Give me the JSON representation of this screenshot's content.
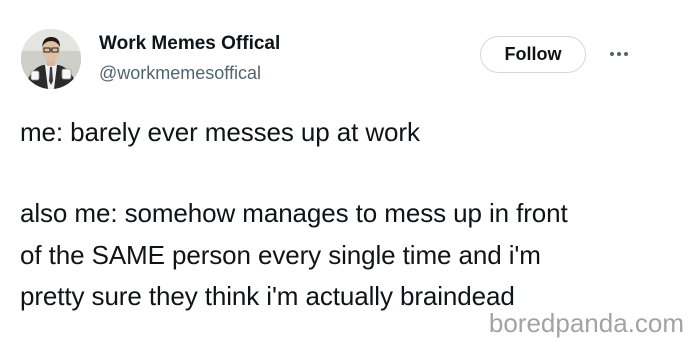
{
  "author": {
    "display_name": "Work Memes Offical",
    "handle": "@workmemesoffical"
  },
  "actions": {
    "follow_label": "Follow",
    "more_icon": "more-horizontal-icon"
  },
  "tweet": {
    "lines": [
      "me: barely ever messes up at work",
      "also me: somehow manages to mess up in front",
      "of the SAME person every single time and i'm",
      "pretty sure they think i'm actually braindead"
    ]
  },
  "watermark": {
    "text": "boredpanda.com"
  },
  "colors": {
    "text_primary": "#0f1419",
    "text_secondary": "#536471",
    "button_border": "#cfd9de",
    "watermark": "#a3a3a3"
  }
}
